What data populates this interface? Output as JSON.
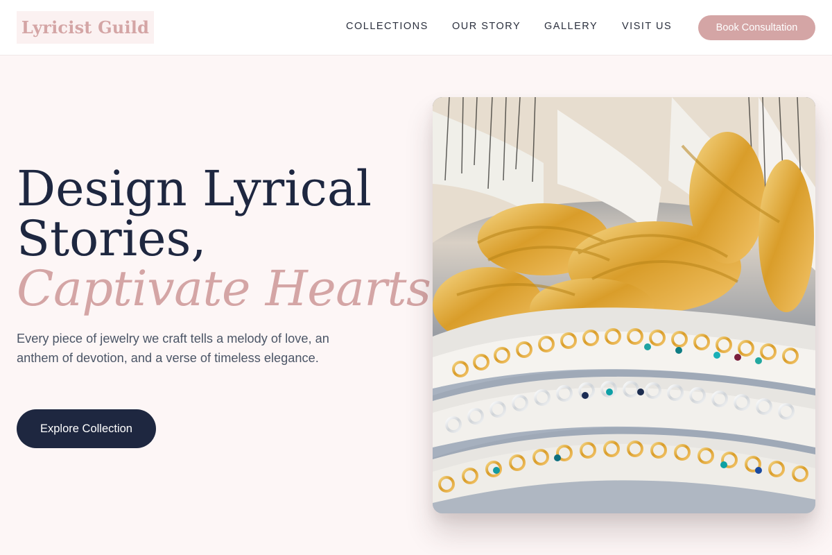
{
  "header": {
    "logo_text": "Lyricist Guild",
    "nav": [
      {
        "label": "COLLECTIONS"
      },
      {
        "label": "OUR STORY"
      },
      {
        "label": "GALLERY"
      },
      {
        "label": "VISIT US"
      }
    ],
    "cta_label": "Book Consultation"
  },
  "hero": {
    "title_line1": "Design Lyrical",
    "title_line2": "Stories,",
    "title_line3": "Captivate Hearts.",
    "copy": "Every piece of jewelry we craft tells a melody of love, an anthem of devotion, and a verse of timeless elegance.",
    "button_label": "Explore Collection",
    "image_icon": "jewelry-display-image"
  },
  "colors": {
    "accent": "#d4a5a5",
    "dark": "#1e2740",
    "body_bg": "#fdf6f6",
    "text_muted": "#4b5566"
  }
}
